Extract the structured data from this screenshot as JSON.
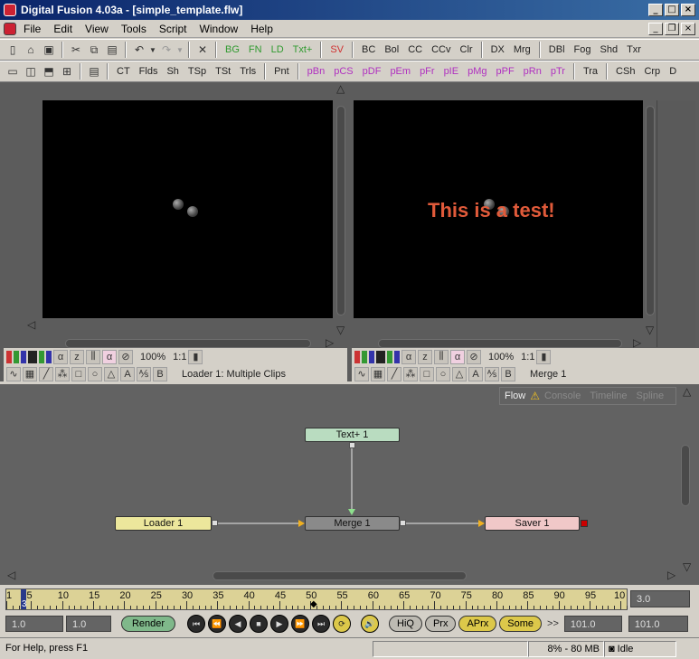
{
  "window": {
    "title": "Digital Fusion 4.03a - [simple_template.flw]"
  },
  "menu": [
    "File",
    "Edit",
    "View",
    "Tools",
    "Script",
    "Window",
    "Help"
  ],
  "toolbar1": {
    "icons": [
      "new-icon",
      "open-icon",
      "save-icon",
      "cut-icon",
      "copy-icon",
      "paste-icon",
      "undo-icon",
      "redo-icon",
      "delete-icon"
    ],
    "green_tools": [
      "BG",
      "FN",
      "LD",
      "Txt+"
    ],
    "red_tools": [
      "SV"
    ],
    "tools": [
      "BC",
      "Bol",
      "CC",
      "CCv",
      "Clr",
      "DX",
      "Mrg",
      "DBl",
      "Fog",
      "Shd",
      "Txr"
    ]
  },
  "toolbar2": {
    "tools_a": [
      "CT",
      "Flds",
      "Sh",
      "TSp",
      "TSt",
      "Trls",
      "Pnt"
    ],
    "pink_tools": [
      "pBn",
      "pCS",
      "pDF",
      "pEm",
      "pFr",
      "pIE",
      "pMg",
      "pPF",
      "pRn",
      "pTr"
    ],
    "tools_b": [
      "Tra",
      "CSh",
      "Crp",
      "D"
    ]
  },
  "viewer_left": {
    "zoom": "100%",
    "ratio": "1:1",
    "label": "Loader 1: Multiple Clips"
  },
  "viewer_right": {
    "zoom": "100%",
    "ratio": "1:1",
    "label": "Merge 1",
    "overlay_text": "This is a test!"
  },
  "flow_tabs": [
    "Flow",
    "Console",
    "Timeline",
    "Spline"
  ],
  "nodes": {
    "text": "Text+ 1",
    "loader": "Loader 1",
    "merge": "Merge 1",
    "saver": "Saver 1"
  },
  "timeline": {
    "current_frame": "3",
    "labels": [
      "1",
      "5",
      "10",
      "15",
      "20",
      "25",
      "30",
      "35",
      "40",
      "45",
      "50",
      "55",
      "60",
      "65",
      "70",
      "75",
      "80",
      "85",
      "90",
      "95",
      "10"
    ],
    "end_field": "3.0"
  },
  "controls": {
    "start": "1.0",
    "render_start": "1.0",
    "render": "Render",
    "hiq": "HiQ",
    "prx": "Prx",
    "aprx": "APrx",
    "some": "Some",
    "chevrons": ">>",
    "render_end": "101.0",
    "end": "101.0"
  },
  "status": {
    "help": "For Help, press F1",
    "memory": "8% -  80 MB",
    "state": "Idle"
  },
  "colors": {
    "viewer_bg": "#000000",
    "panel_bg": "#5c5c5c",
    "overlay_text": "#e05a3a",
    "text_node": "#b9dcc0",
    "loader_node": "#ece79c",
    "merge_node": "#8a8a8a",
    "saver_node": "#f0c8c8"
  }
}
